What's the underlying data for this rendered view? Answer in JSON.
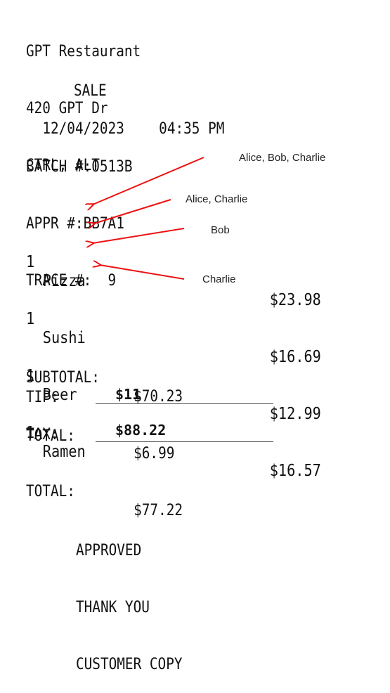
{
  "receipt": {
    "header": {
      "name": "GPT Restaurant",
      "address": "420 GPT Dr",
      "city": "CTRL, ALT"
    },
    "transaction_type": "SALE",
    "date": "12/04/2023",
    "time": "04:35 PM",
    "batch": "BATCH #:0513B",
    "approval": "APPR #:BB7A1",
    "trace": "TRACE #:  9",
    "items": [
      {
        "qty": "1",
        "name": "Pizza",
        "price": "$23.98"
      },
      {
        "qty": "1",
        "name": "Sushi",
        "price": "$16.69"
      },
      {
        "qty": "1",
        "name": "Beer",
        "price": "$12.99"
      },
      {
        "qty": "1",
        "name": "Ramen",
        "price": "$16.57"
      }
    ],
    "subtotal": {
      "label": "SUBTOTAL:",
      "value": "$70.23"
    },
    "tax": {
      "label": "TAX:",
      "value": "$6.99"
    },
    "total": {
      "label": "TOTAL:",
      "value": "$77.22"
    },
    "tip": {
      "label": "TIP:",
      "value": "$11"
    },
    "grand_total": {
      "label": "TOTAL:",
      "value": "$88.22"
    },
    "footer": [
      "APPROVED",
      "THANK YOU",
      "CUSTOMER COPY"
    ]
  },
  "annotations": [
    {
      "text": "Alice, Bob, Charlie",
      "target": "Pizza"
    },
    {
      "text": "Alice, Charlie",
      "target": "Sushi"
    },
    {
      "text": "Bob",
      "target": "Beer"
    },
    {
      "text": "Charlie",
      "target": "Ramen"
    }
  ],
  "colors": {
    "arrow": "#ee1111",
    "ink": "#111111"
  }
}
